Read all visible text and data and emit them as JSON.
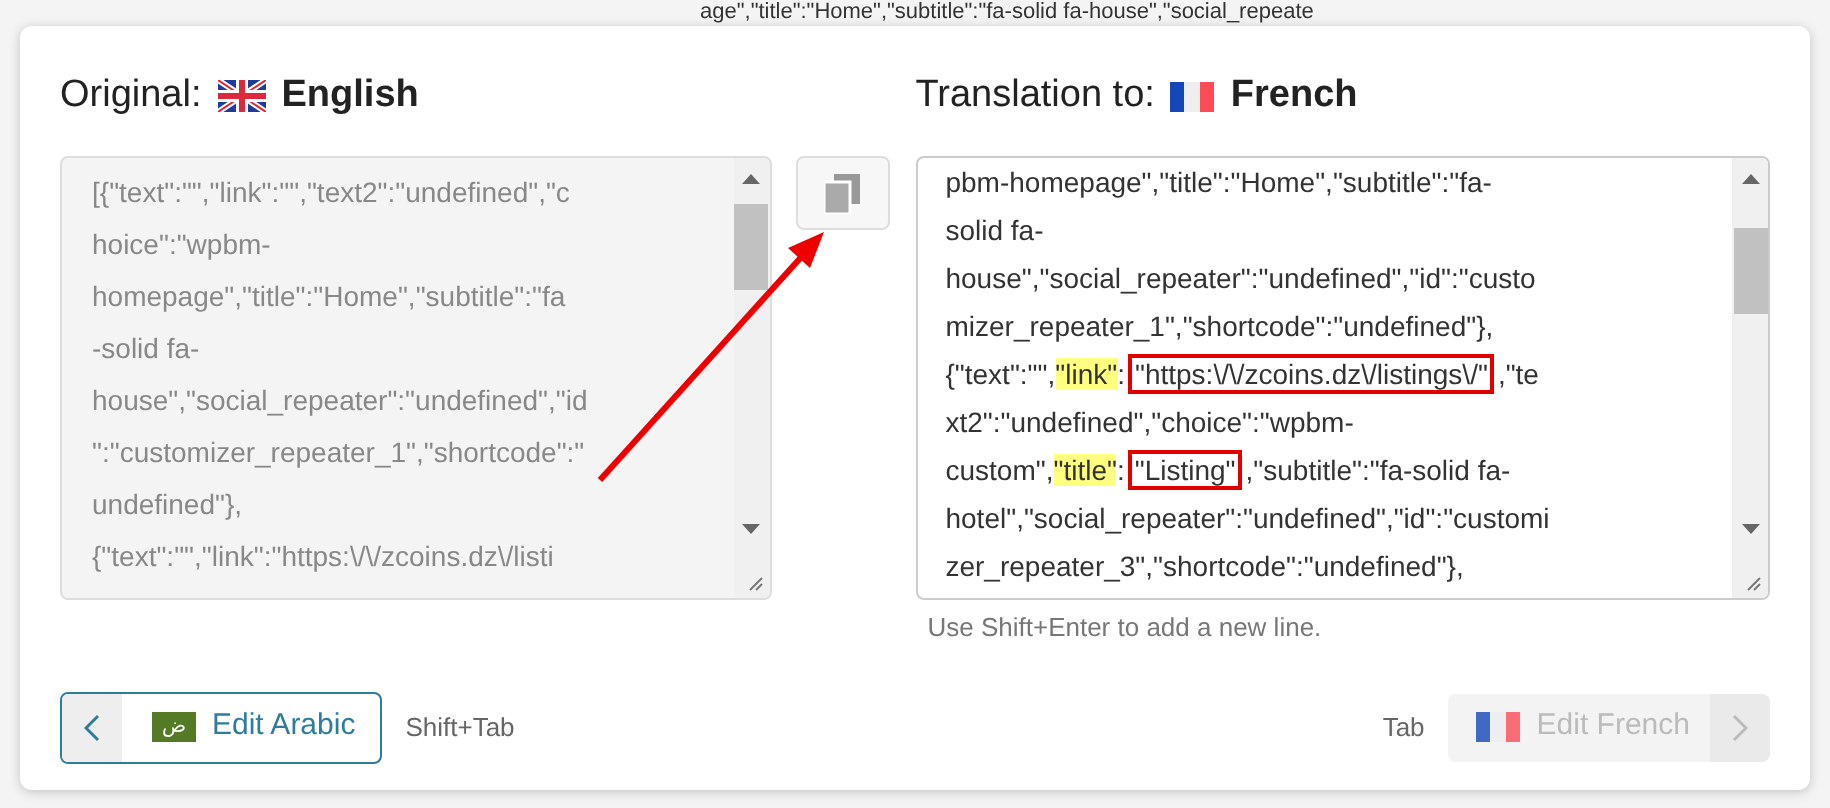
{
  "background_text": "age\",\"title\":\"Home\",\"subtitle\":\"fa-solid fa-house\",\"social_repeate",
  "original": {
    "label": "Original:",
    "language": "English",
    "disabled": true,
    "lines": [
      "[{\"text\":\"\",\"link\":\"\",\"text2\":\"undefined\",\"c",
      "hoice\":\"wpbm-",
      "homepage\",\"title\":\"Home\",\"subtitle\":\"fa",
      "-solid fa-",
      "house\",\"social_repeater\":\"undefined\",\"id",
      "\":\"customizer_repeater_1\",\"shortcode\":\"",
      "undefined\"},",
      "{\"text\":\"\",\"link\":\"https:\\/\\/zcoins.dz\\/listi"
    ]
  },
  "translation": {
    "label": "Translation to:",
    "language": "French",
    "lines": [
      [
        {
          "kind": "plain",
          "text": "pbm-homepage\",\"title\":\"Home\",\"subtitle\":\"fa-"
        }
      ],
      [
        {
          "kind": "plain",
          "text": "solid fa-"
        }
      ],
      [
        {
          "kind": "plain",
          "text": "house\",\"social_repeater\":\"undefined\",\"id\":\"custo"
        }
      ],
      [
        {
          "kind": "plain",
          "text": "mizer_repeater_1\",\"shortcode\":\"undefined\"},"
        }
      ],
      [
        {
          "kind": "plain",
          "text": "{\"text\":\"\","
        },
        {
          "kind": "highlight",
          "text": "\"link\""
        },
        {
          "kind": "plain",
          "text": ":"
        },
        {
          "kind": "boxed",
          "text": "\"https:\\/\\/zcoins.dz\\/listings\\/\""
        },
        {
          "kind": "plain",
          "text": ",\"te"
        }
      ],
      [
        {
          "kind": "plain",
          "text": "xt2\":\"undefined\",\"choice\":\"wpbm-"
        }
      ],
      [
        {
          "kind": "plain",
          "text": "custom\","
        },
        {
          "kind": "highlight",
          "text": "\"title\""
        },
        {
          "kind": "plain",
          "text": ":"
        },
        {
          "kind": "boxed",
          "text": "\"Listing\""
        },
        {
          "kind": "plain",
          "text": ",\"subtitle\":\"fa-solid fa-"
        }
      ],
      [
        {
          "kind": "plain",
          "text": "hotel\",\"social_repeater\":\"undefined\",\"id\":\"customi"
        }
      ],
      [
        {
          "kind": "plain",
          "text": "zer_repeater_3\",\"shortcode\":\"undefined\"},"
        }
      ]
    ]
  },
  "hint": "Use Shift+Enter to add a new line.",
  "prev_button": {
    "label": "Edit Arabic",
    "flag_text": "ض",
    "shortcut": "Shift+Tab",
    "disabled": false
  },
  "next_button": {
    "label": "Edit French",
    "shortcut": "Tab",
    "disabled": true
  }
}
